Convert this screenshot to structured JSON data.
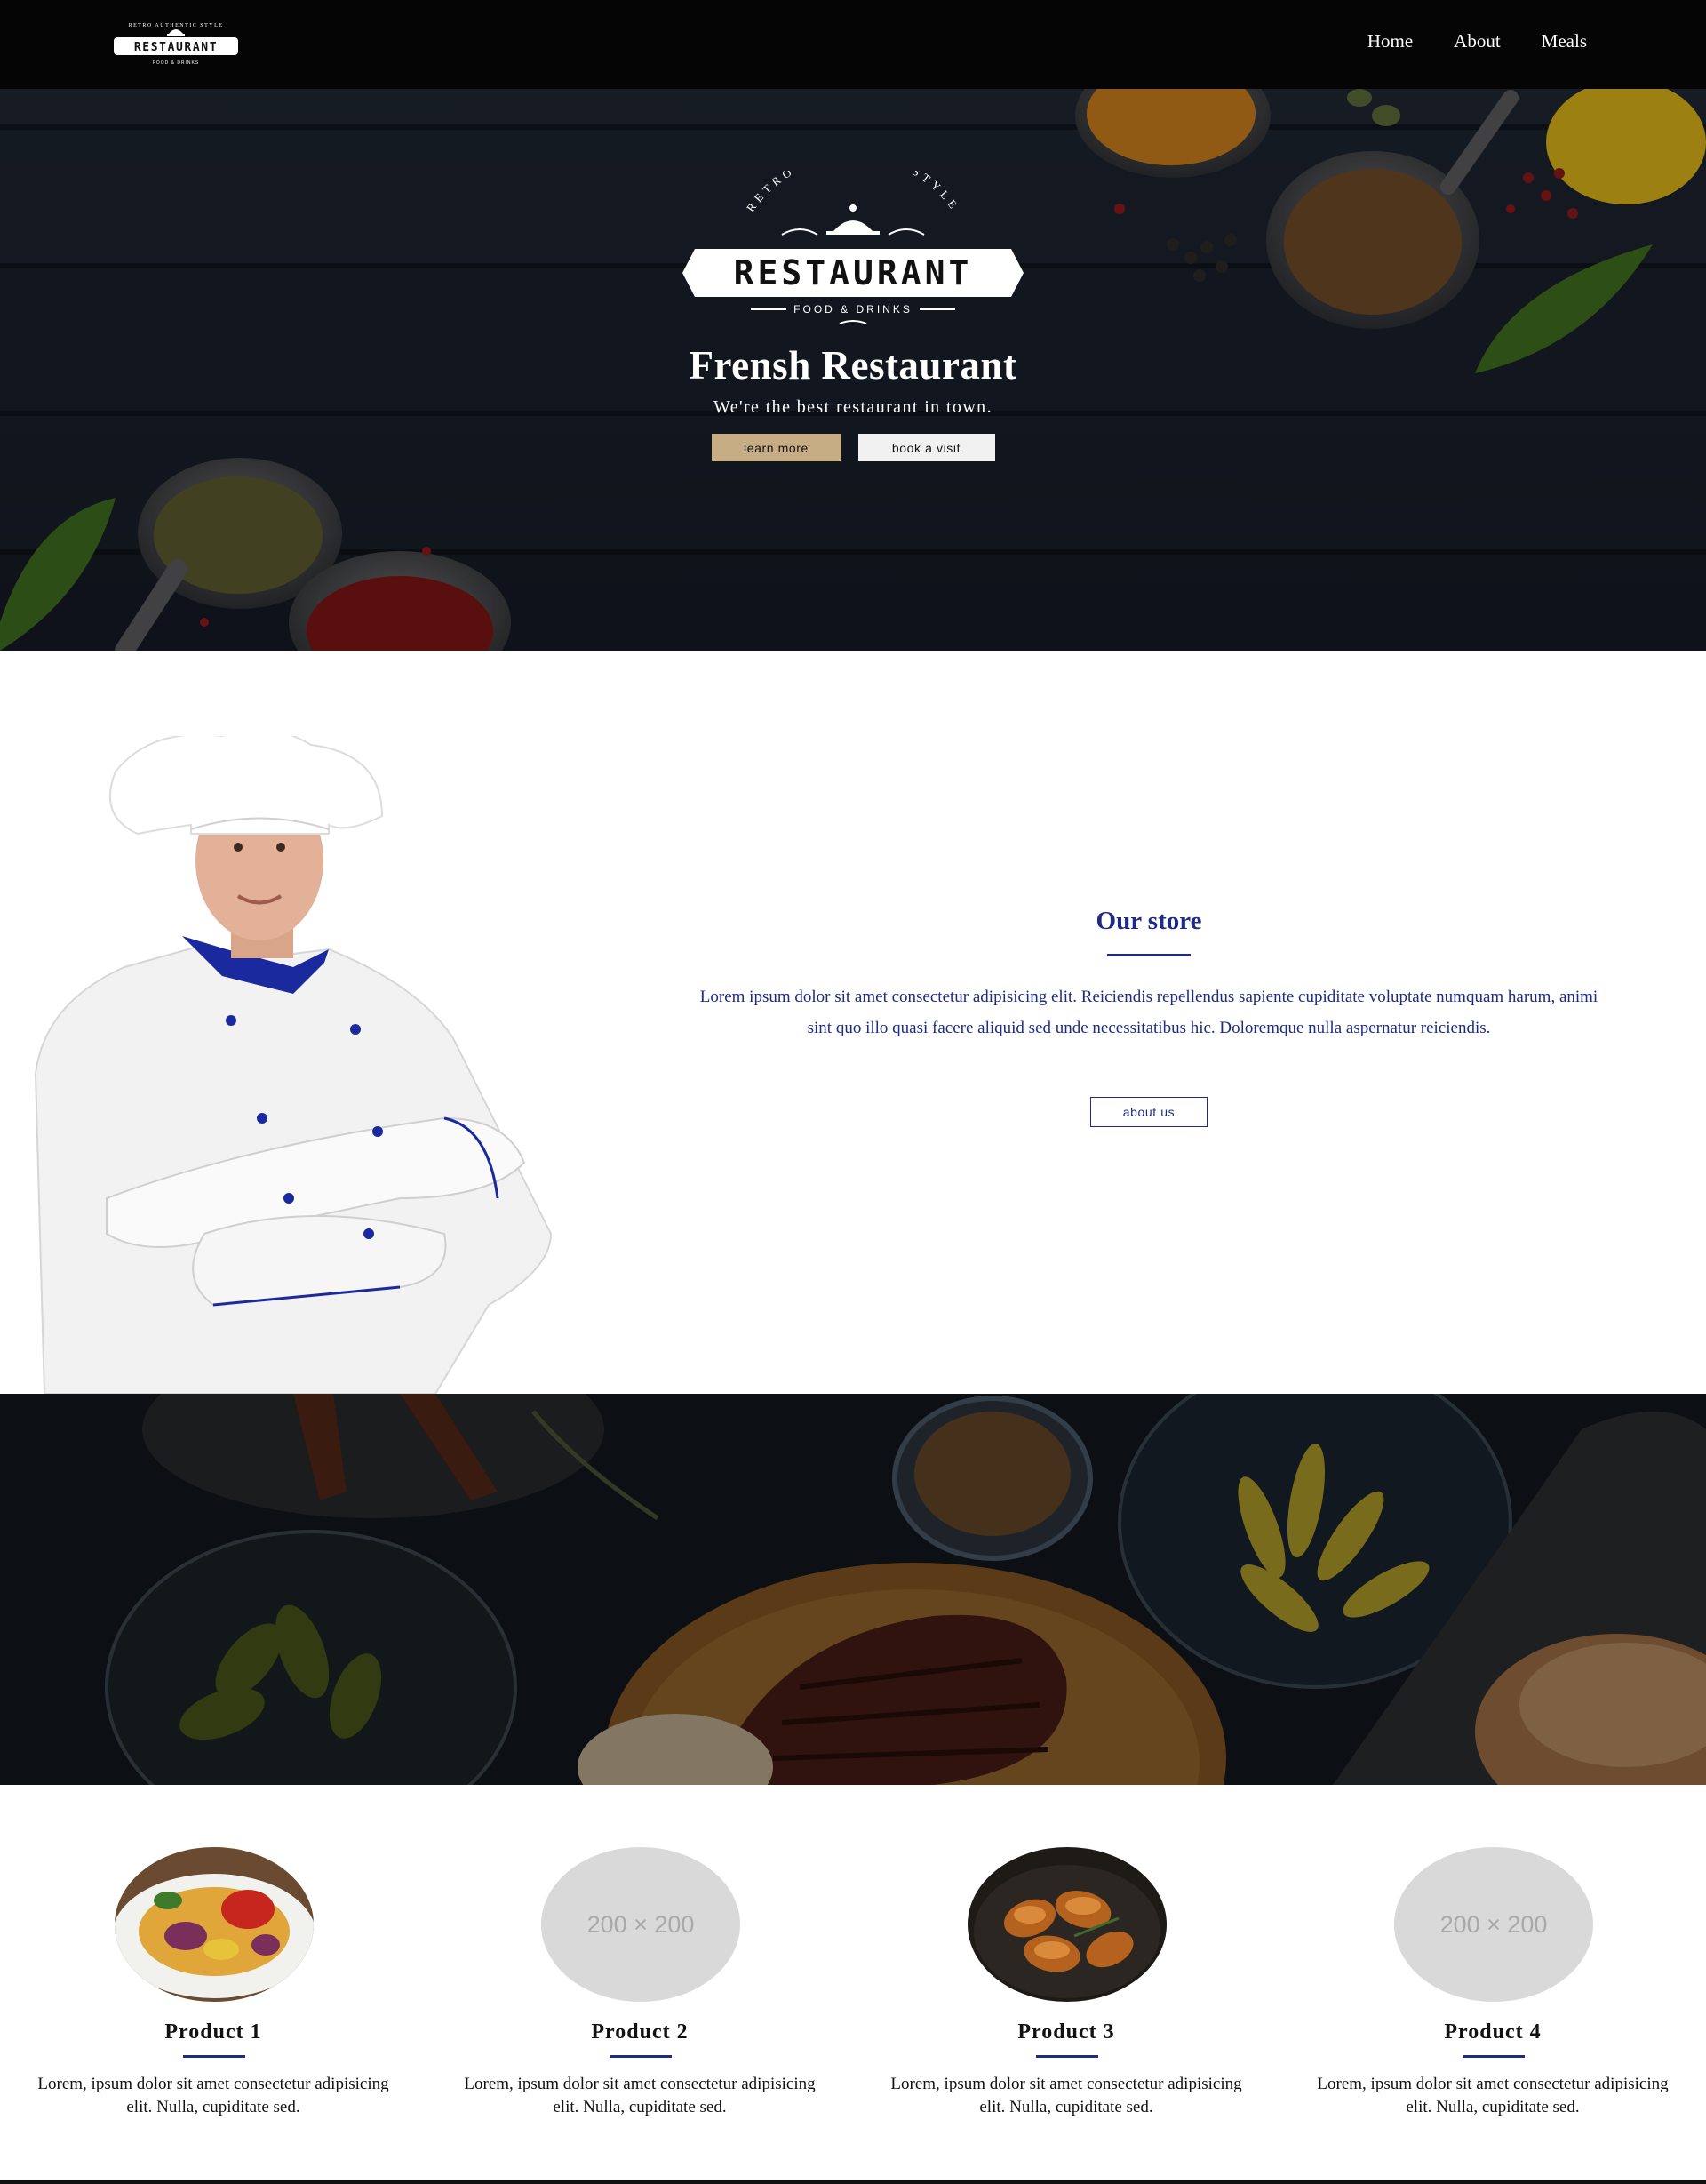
{
  "nav": {
    "logo": {
      "arc_text": "RETRO AUTHENTIC STYLE",
      "word": "RESTAURANT",
      "tagline": "FOOD & DRINKS"
    },
    "links": [
      "Home",
      "About",
      "Meals"
    ]
  },
  "hero": {
    "logo": {
      "arc_text": "RETRO AUTHENTIC STYLE",
      "word": "RESTAURANT",
      "tagline": "FOOD & DRINKS"
    },
    "title": "Frensh Restaurant",
    "subtitle": "We're the best restaurant in town.",
    "primary_button": "learn more",
    "secondary_button": "book a visit"
  },
  "store": {
    "title": "Our store",
    "text": "Lorem ipsum dolor sit amet consectetur adipisicing elit. Reiciendis repellendus sapiente cupiditate voluptate numquam harum, animi sint quo illo quasi facere aliquid sed unde necessitatibus hic. Doloremque nulla aspernatur reiciendis.",
    "button": "about us"
  },
  "products": [
    {
      "name": "Product 1",
      "text": "Lorem, ipsum dolor sit amet consectetur adipisicing elit. Nulla, cupiditate sed.",
      "image": "pasta-dish"
    },
    {
      "name": "Product 2",
      "text": "Lorem, ipsum dolor sit amet consectetur adipisicing elit. Nulla, cupiditate sed.",
      "image": "placeholder",
      "placeholder_text": "200 × 200"
    },
    {
      "name": "Product 3",
      "text": "Lorem, ipsum dolor sit amet consectetur adipisicing elit. Nulla, cupiditate sed.",
      "image": "roast-chicken"
    },
    {
      "name": "Product 4",
      "text": "Lorem, ipsum dolor sit amet consectetur adipisicing elit. Nulla, cupiditate sed.",
      "image": "placeholder",
      "placeholder_text": "200 × 200"
    }
  ],
  "colors": {
    "accent_blue": "#1d2b86",
    "tan_button": "#c7ad84",
    "navbar": "#050505"
  }
}
